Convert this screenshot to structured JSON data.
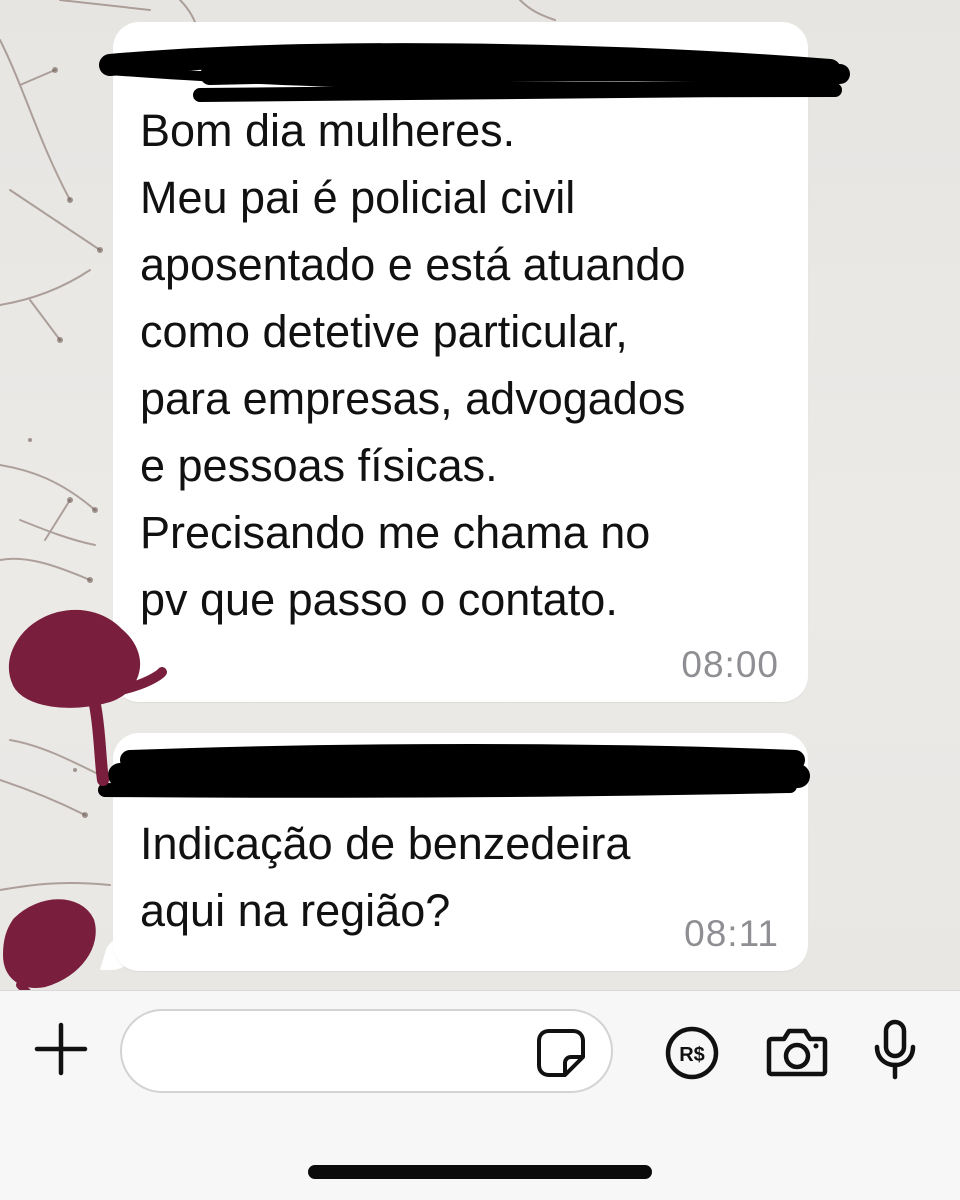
{
  "app": {
    "accent_color": "#ffffff",
    "background_color": "#e9e7e4"
  },
  "messages": [
    {
      "sender_redacted": true,
      "lines": [
        "Bom dia mulheres.",
        "Meu pai é policial civil",
        "aposentado e está atuando",
        "como detetive particular,",
        "para empresas, advogados",
        "e pessoas físicas.",
        "Precisando me chama no",
        "pv que passo o contato."
      ],
      "time": "08:00"
    },
    {
      "sender_redacted": true,
      "lines": [
        "Indicação de benzedeira",
        "aqui na região?"
      ],
      "time": "08:11"
    }
  ],
  "composer": {
    "placeholder": "",
    "value": ""
  },
  "icons": {
    "left": "plus-icon",
    "in_field": "sticker-icon",
    "right": [
      "payment-icon",
      "camera-icon",
      "microphone-icon"
    ]
  },
  "payment_icon_label": "R$"
}
